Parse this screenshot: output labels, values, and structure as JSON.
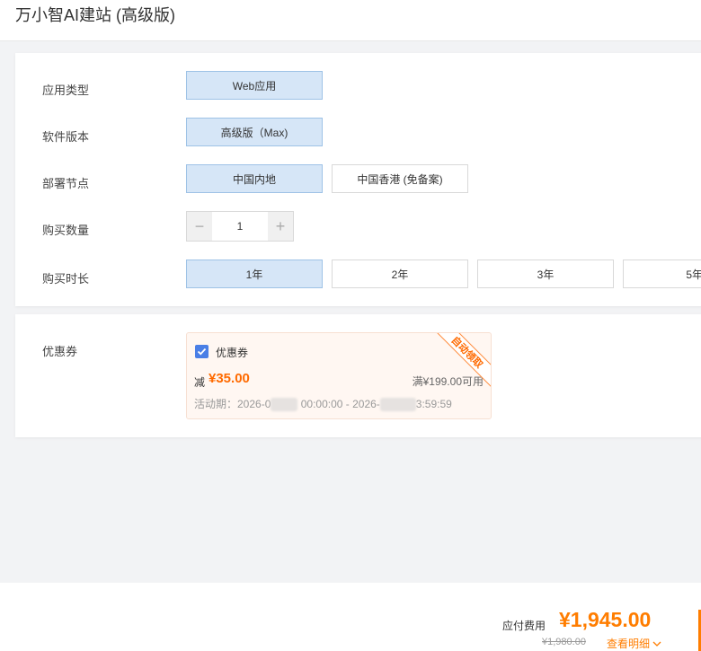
{
  "header": {
    "title": "万小智AI建站 (高级版)"
  },
  "config": {
    "app_type": {
      "label": "应用类型",
      "options": [
        "Web应用"
      ],
      "selected": 0
    },
    "version": {
      "label": "软件版本",
      "options": [
        "高级版（Max)"
      ],
      "selected": 0
    },
    "region": {
      "label": "部署节点",
      "options": [
        "中国内地",
        "中国香港 (免备案)"
      ],
      "selected": 0
    },
    "quantity": {
      "label": "购买数量",
      "minus": "−",
      "plus": "+",
      "value": "1"
    },
    "duration": {
      "label": "购买时长",
      "options": [
        "1年",
        "2年",
        "3年",
        "5年"
      ],
      "selected": 0
    }
  },
  "coupon": {
    "label": "优惠券",
    "name": "优惠券",
    "checked": true,
    "minus_prefix": "减",
    "amount": "¥35.00",
    "threshold": "满¥199.00可用",
    "ribbon": "自动领取",
    "period_prefix": "活动期：2026-0",
    "period_mid": "00:00:00 - 2026-",
    "period_suffix": "3:59:59"
  },
  "footer": {
    "fee_label": "应付费用",
    "fee_amount": "¥1,945.00",
    "original_price": "¥1,980.00",
    "detail_link": "查看明细",
    "accent_color": "#ff7d00"
  },
  "colors": {
    "selected_bg": "#d6e6f7",
    "price_orange": "#ff6a00",
    "checkbox_blue": "#4a7fe6"
  }
}
